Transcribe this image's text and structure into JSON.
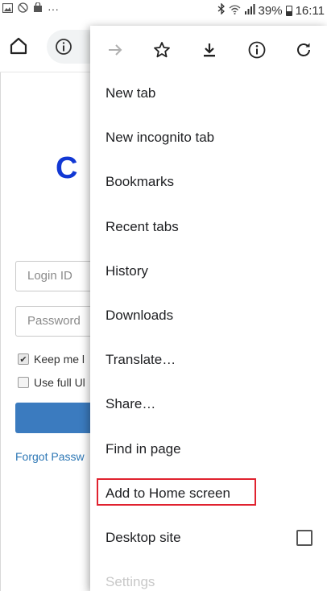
{
  "status_bar": {
    "left_icons": [
      "image-icon",
      "blocked-icon",
      "bag-icon",
      "more-icon"
    ],
    "more_text": "···",
    "battery": "39%",
    "time": "16:11"
  },
  "page": {
    "logo_text": "C",
    "login_placeholder": "Login ID",
    "password_placeholder": "Password",
    "keep_me_label": "Keep me l",
    "use_full_label": "Use full Ul",
    "forgot_link": "Forgot Passw",
    "login_button_color": "#3b7bbf"
  },
  "menu": {
    "icons": [
      "forward-icon",
      "star-icon",
      "download-icon",
      "info-icon",
      "refresh-icon"
    ],
    "items": [
      {
        "label": "New tab"
      },
      {
        "label": "New incognito tab"
      },
      {
        "label": "Bookmarks"
      },
      {
        "label": "Recent tabs"
      },
      {
        "label": "History"
      },
      {
        "label": "Downloads"
      },
      {
        "label": "Translate…"
      },
      {
        "label": "Share…"
      },
      {
        "label": "Find in page"
      },
      {
        "label": "Add to Home screen"
      },
      {
        "label": "Desktop site"
      },
      {
        "label": "Settings"
      }
    ],
    "highlight_color": "#e0222f",
    "desktop_site_checked": false
  }
}
